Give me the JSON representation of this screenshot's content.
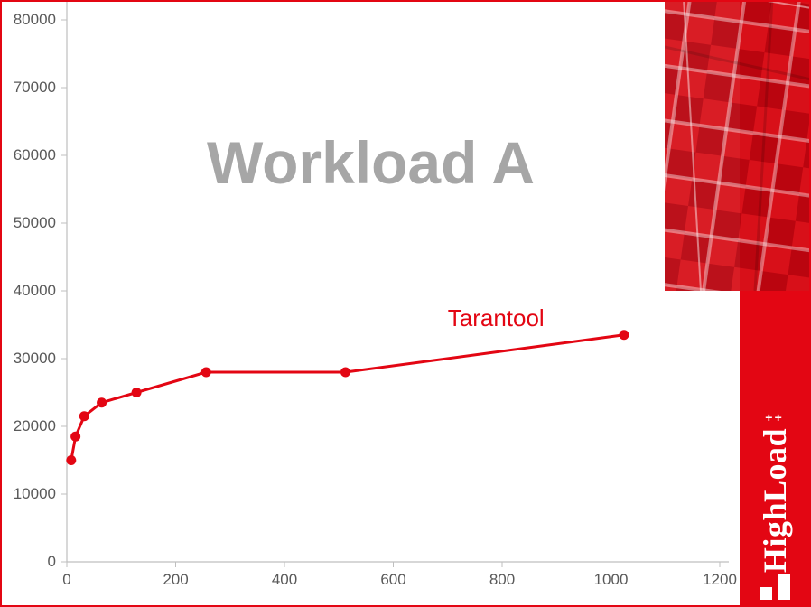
{
  "chart_data": {
    "type": "line",
    "title": "Workload A",
    "series_name": "Tarantool",
    "x": [
      8,
      16,
      32,
      64,
      128,
      256,
      512,
      1024
    ],
    "y": [
      15000,
      18500,
      21500,
      23500,
      25000,
      28000,
      28000,
      33500
    ],
    "x_ticks": [
      0,
      200,
      400,
      600,
      800,
      1000,
      1200
    ],
    "y_ticks": [
      0,
      10000,
      20000,
      30000,
      40000,
      50000,
      60000,
      70000,
      80000
    ],
    "xlabel": "",
    "ylabel": "",
    "xlim": [
      0,
      1200
    ],
    "ylim": [
      0,
      80000
    ],
    "color": "#e30613"
  },
  "brand": {
    "name": "HighLoad",
    "superscript": "++"
  }
}
